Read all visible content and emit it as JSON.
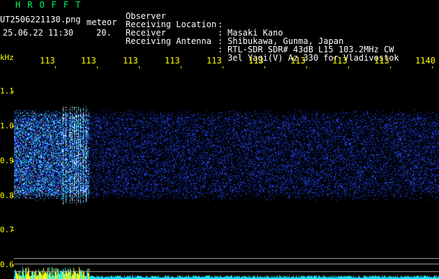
{
  "header": {
    "app_title": "HROFFT",
    "file_name": "UT2506221130.png",
    "tag": "meteor",
    "date_time": "25.06.22 11:30",
    "interval": "20."
  },
  "meta": [
    {
      "key": "Observer",
      "value": "Masaki Kano"
    },
    {
      "key": "Receiving Location",
      "value": "Shibukawa, Gunma, Japan"
    },
    {
      "key": "Receiver",
      "value": "RTL-SDR SDR# 43dB L15 103.2MHz CW"
    },
    {
      "key": "Receiving Antenna",
      "value": "3el Yagi(V) Az 330 for Vladivostok"
    }
  ],
  "axis": {
    "y_unit": "kHz",
    "y_ticks": [
      "1.1",
      "1.0",
      "0.9",
      "0.8",
      "0.7",
      "0.6"
    ],
    "x_ticks": [
      "113",
      "113",
      "113",
      "113",
      "113",
      "113",
      "113",
      "113",
      "113",
      "1140"
    ]
  },
  "colors": {
    "text_green": "#00ff66",
    "tick_yellow": "#ffff00",
    "signal_blue": "#1a3cff"
  }
}
